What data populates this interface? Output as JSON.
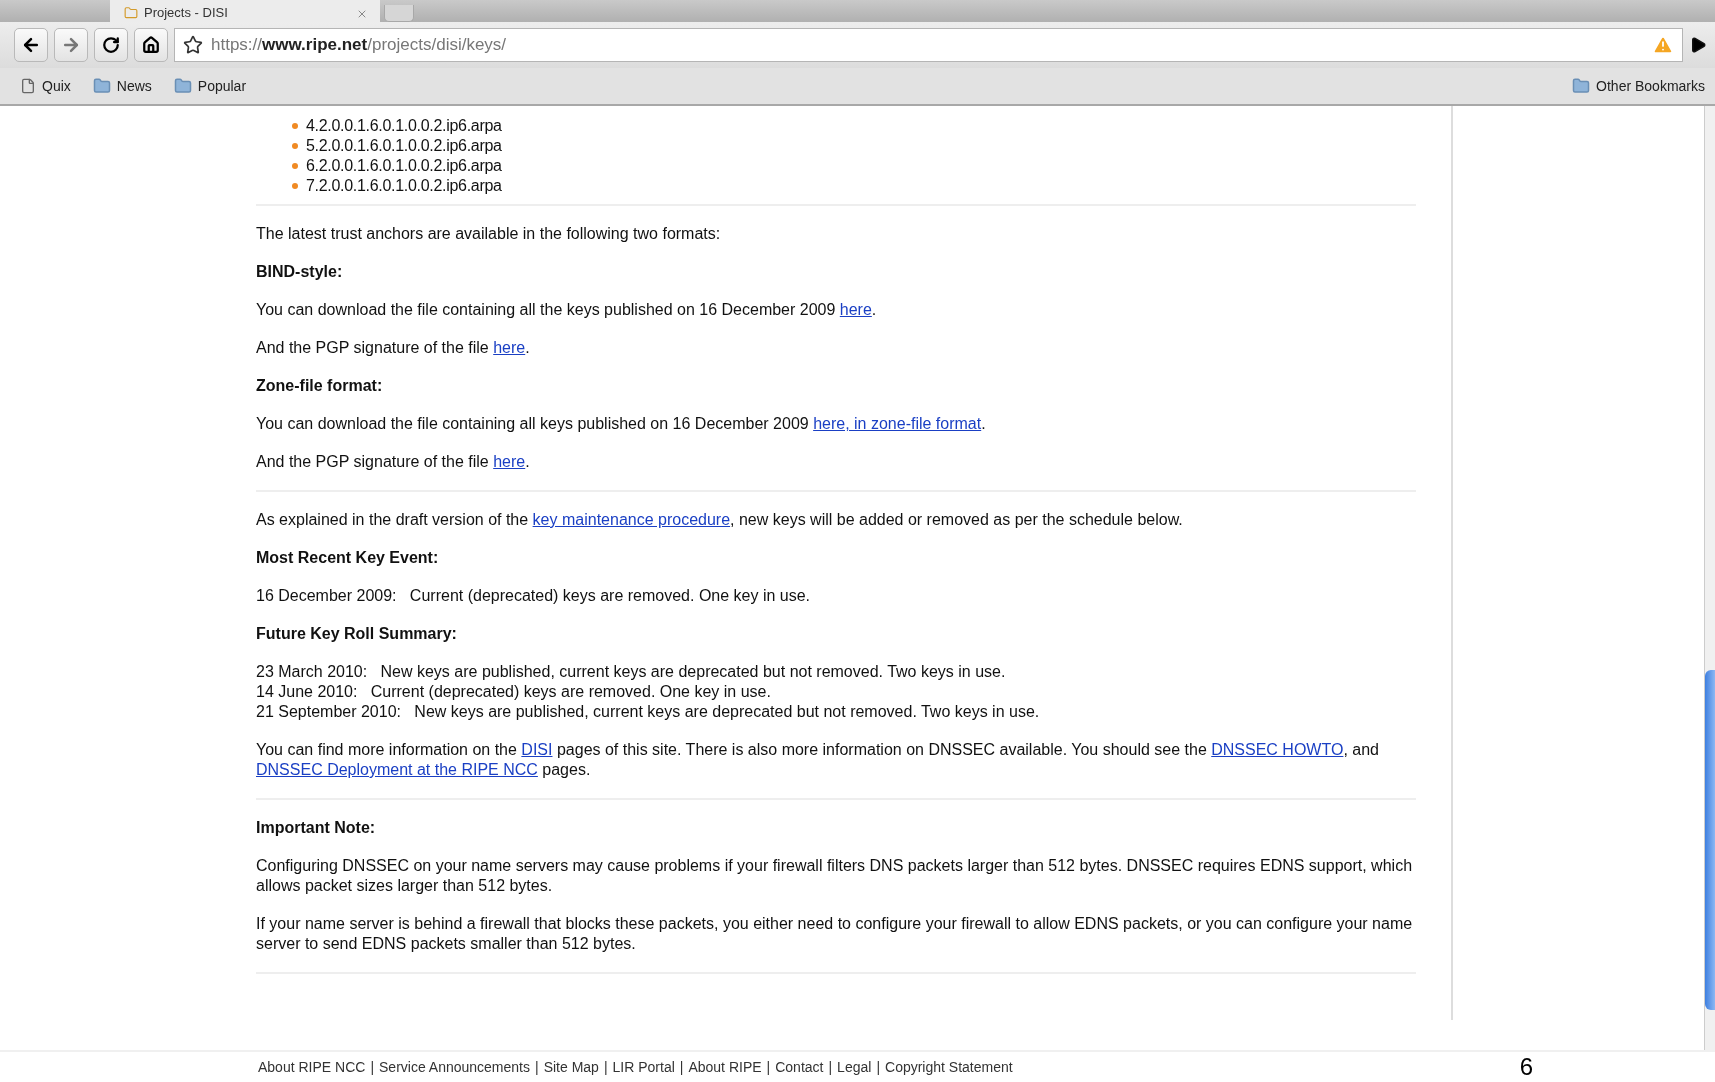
{
  "tab": {
    "title": "Projects - DISI"
  },
  "address": {
    "scheme": "https://",
    "host": "www.ripe.net",
    "path": "/projects/disi/keys/"
  },
  "bookmarks": [
    {
      "kind": "page",
      "label": "Quix"
    },
    {
      "kind": "folder",
      "label": "News"
    },
    {
      "kind": "folder",
      "label": "Popular"
    }
  ],
  "other_bookmarks": "Other Bookmarks",
  "zone_list": [
    "4.2.0.0.1.6.0.1.0.0.2.ip6.arpa",
    "5.2.0.0.1.6.0.1.0.0.2.ip6.arpa",
    "6.2.0.0.1.6.0.1.0.0.2.ip6.arpa",
    "7.2.0.0.1.6.0.1.0.0.2.ip6.arpa"
  ],
  "content": [
    {
      "kind": "rule"
    },
    {
      "kind": "text",
      "parts": [
        {
          "text": "The latest trust anchors are available in the following two formats:",
          "link": false
        }
      ]
    },
    {
      "kind": "heading",
      "text": "BIND-style:"
    },
    {
      "kind": "text",
      "parts": [
        {
          "text": "You can download the file containing all the keys published on 16 December 2009 ",
          "link": false
        },
        {
          "text": "here",
          "link": true
        },
        {
          "text": ".",
          "link": false
        }
      ]
    },
    {
      "kind": "text",
      "parts": [
        {
          "text": "And the PGP signature of the file ",
          "link": false
        },
        {
          "text": "here",
          "link": true
        },
        {
          "text": ".",
          "link": false
        }
      ]
    },
    {
      "kind": "heading",
      "text": "Zone-file format:"
    },
    {
      "kind": "text",
      "parts": [
        {
          "text": "You can download the file containing all keys published on 16 December 2009 ",
          "link": false
        },
        {
          "text": "here, in zone-file format",
          "link": true
        },
        {
          "text": ".",
          "link": false
        }
      ]
    },
    {
      "kind": "text",
      "parts": [
        {
          "text": "And the PGP signature of the file ",
          "link": false
        },
        {
          "text": "here",
          "link": true
        },
        {
          "text": ".",
          "link": false
        }
      ]
    },
    {
      "kind": "rule"
    },
    {
      "kind": "text",
      "parts": [
        {
          "text": "As explained in the draft version of the ",
          "link": false
        },
        {
          "text": "key maintenance procedure",
          "link": true
        },
        {
          "text": ", new keys will be added or removed as per the schedule below.",
          "link": false
        }
      ]
    },
    {
      "kind": "heading",
      "text": "Most Recent Key Event:"
    },
    {
      "kind": "text",
      "parts": [
        {
          "text": "16 December 2009:   Current (deprecated) keys are removed. One key in use.",
          "link": false
        }
      ]
    },
    {
      "kind": "heading",
      "text": "Future Key Roll Summary:"
    },
    {
      "kind": "lines",
      "lines": [
        "23 March 2010:   New keys are published, current keys are deprecated but not removed. Two keys in use.",
        "14 June 2010:   Current (deprecated) keys are removed. One key in use.",
        "21 September 2010:   New keys are published, current keys are deprecated but not removed. Two keys in use."
      ]
    },
    {
      "kind": "text",
      "parts": [
        {
          "text": "You can find more information on the ",
          "link": false
        },
        {
          "text": "DISI",
          "link": true
        },
        {
          "text": " pages of this site. There is also more information on DNSSEC available. You should see the ",
          "link": false
        },
        {
          "text": "DNSSEC HOWTO",
          "link": true
        },
        {
          "text": ", and ",
          "link": false
        },
        {
          "text": "DNSSEC Deployment at the RIPE NCC",
          "link": true
        },
        {
          "text": " pages.",
          "link": false
        }
      ]
    },
    {
      "kind": "rule"
    },
    {
      "kind": "heading",
      "text": "Important Note:"
    },
    {
      "kind": "text",
      "parts": [
        {
          "text": "Configuring DNSSEC on your name servers may cause problems if your firewall filters DNS packets larger than 512 bytes. DNSSEC requires EDNS support, which allows packet sizes larger than 512 bytes.",
          "link": false
        }
      ]
    },
    {
      "kind": "text",
      "parts": [
        {
          "text": "If your name server is behind a firewall that blocks these packets, you either need to configure your firewall to allow EDNS packets, or you can configure your name server to send EDNS packets smaller than 512 bytes.",
          "link": false
        }
      ]
    },
    {
      "kind": "rule"
    }
  ],
  "footer": {
    "separator": "|",
    "links": [
      "About RIPE NCC",
      "Service Announcements",
      "Site Map",
      "LIR Portal",
      "About RIPE",
      "Contact",
      "Legal",
      "Copyright Statement"
    ]
  },
  "page_number": "6"
}
